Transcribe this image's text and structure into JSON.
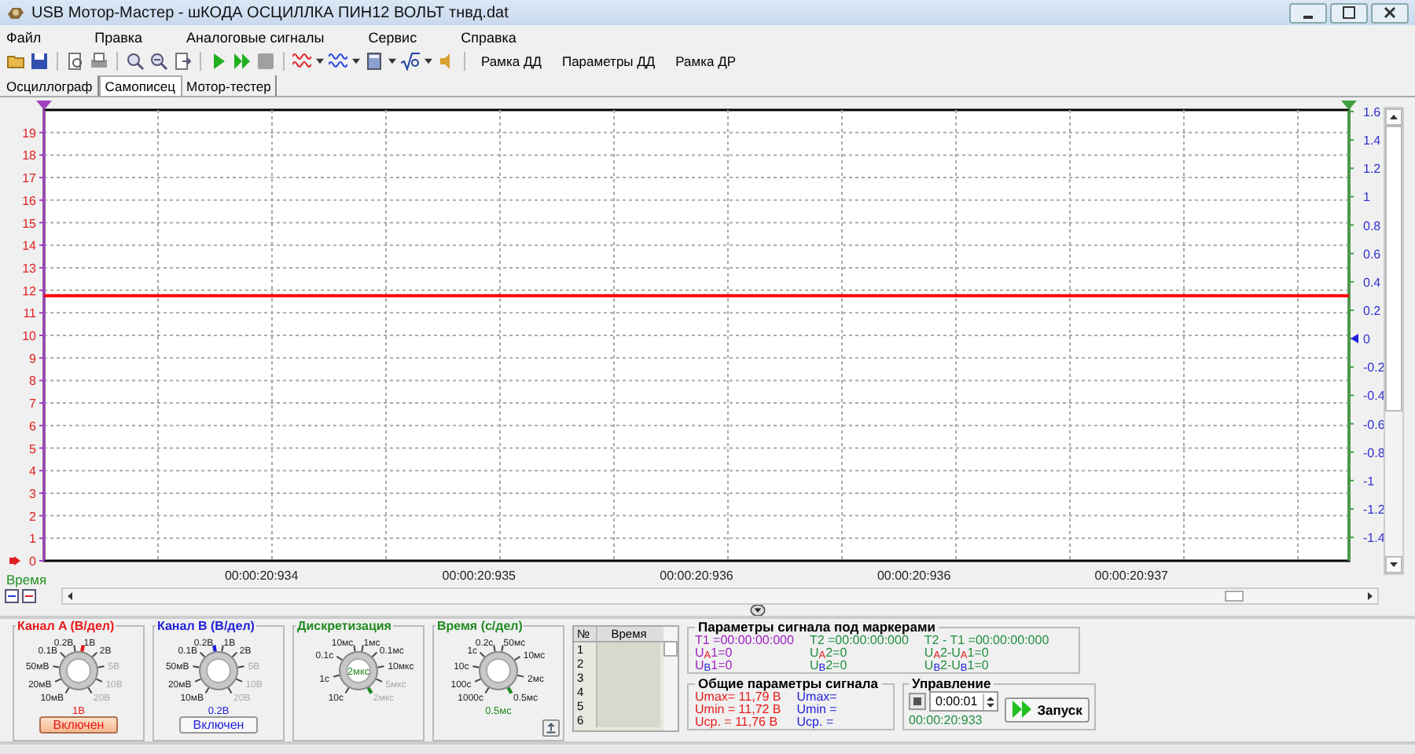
{
  "window": {
    "title": "USB Мотор-Мастер - шКОДА ОСЦИЛЛКА ПИН12 ВОЛЬТ тнвд.dat"
  },
  "menu": [
    "Файл",
    "Правка",
    "Аналоговые сигналы",
    "Сервис",
    "Справка"
  ],
  "toolbar": {
    "stop": {
      "disabled": true
    },
    "text_buttons": [
      "Рамка ДД",
      "Параметры ДД",
      "Рамка ДР"
    ]
  },
  "tabs": [
    {
      "label": "Осциллограф",
      "selected": false
    },
    {
      "label": "Самописец",
      "selected": true
    },
    {
      "label": "Мотор-тестер",
      "selected": false
    }
  ],
  "chart": {
    "chart_data": {
      "type": "line",
      "xlabel": "Время",
      "ylim": [
        0,
        20
      ],
      "grid": true,
      "categories": [
        null,
        "00:00:20:934",
        "00:00:20:935",
        "00:00:20:936",
        "00:00:20:936",
        "00:00:20:937",
        null
      ],
      "yticks": [
        0,
        1,
        2,
        3,
        4,
        5,
        6,
        7,
        8,
        9,
        10,
        11,
        12,
        13,
        14,
        15,
        16,
        17,
        18,
        19
      ],
      "series": [
        {
          "color": "#ff0000",
          "values": [
            11.76,
            11.76,
            11.76,
            11.76,
            11.76,
            11.76,
            11.76
          ]
        }
      ]
    },
    "right_axis": {
      "ticks": [
        "1.6",
        "1.4",
        "1.2",
        "1",
        "0.8",
        "0.6",
        "0.4",
        "0.2",
        "0",
        "-0.2",
        "-0.4",
        "-0.6",
        "-0.8",
        "-1",
        "-1.2",
        "-1.4"
      ]
    }
  },
  "dials": [
    {
      "title": "Канал A (В/дел)",
      "color": "#e81818",
      "kind": "value-below",
      "value": "1В",
      "left_labels": [
        {
          "text": "0.2В",
          "dimmed": false,
          "selected": false
        },
        {
          "text": "0.1В",
          "dimmed": false,
          "selected": false
        },
        {
          "text": "50мВ",
          "dimmed": false,
          "selected": false
        },
        {
          "text": "20мВ",
          "dimmed": false,
          "selected": false
        },
        {
          "text": "10мВ",
          "dimmed": false,
          "selected": false
        }
      ],
      "right_labels": [
        {
          "text": "1В",
          "dimmed": false,
          "selected": true
        },
        {
          "text": "2В",
          "dimmed": false,
          "selected": false
        },
        {
          "text": "5В",
          "dimmed": true,
          "selected": false
        },
        {
          "text": "10В",
          "dimmed": true,
          "selected": false
        },
        {
          "text": "20В",
          "dimmed": true,
          "selected": false
        }
      ],
      "button": {
        "label": "Включен",
        "pressed": true
      }
    },
    {
      "title": "Канал B (В/дел)",
      "color": "#2020d8",
      "kind": "value-below",
      "value": "0.2В",
      "left_labels": [
        {
          "text": "0.2В",
          "dimmed": false,
          "selected": true
        },
        {
          "text": "0.1В",
          "dimmed": false,
          "selected": false
        },
        {
          "text": "50мВ",
          "dimmed": false,
          "selected": false
        },
        {
          "text": "20мВ",
          "dimmed": false,
          "selected": false
        },
        {
          "text": "10мВ",
          "dimmed": false,
          "selected": false
        }
      ],
      "right_labels": [
        {
          "text": "1В",
          "dimmed": false,
          "selected": false
        },
        {
          "text": "2В",
          "dimmed": false,
          "selected": false
        },
        {
          "text": "5В",
          "dimmed": true,
          "selected": false
        },
        {
          "text": "10В",
          "dimmed": true,
          "selected": false
        },
        {
          "text": "20В",
          "dimmed": true,
          "selected": false
        }
      ],
      "button": {
        "label": "Включен",
        "pressed": false
      }
    },
    {
      "title": "Дискретизация",
      "color": "#208a20",
      "kind": "value-inside",
      "value": "2мкс",
      "left_labels": [
        {
          "text": "10мс",
          "dimmed": false,
          "selected": false
        },
        {
          "text": "0.1с",
          "dimmed": false,
          "selected": false
        },
        {
          "text": "1с",
          "dimmed": false,
          "selected": false
        },
        {
          "text": "10с",
          "dimmed": false,
          "selected": false
        }
      ],
      "right_labels": [
        {
          "text": "1мс",
          "dimmed": false,
          "selected": false
        },
        {
          "text": "0.1мс",
          "dimmed": false,
          "selected": false
        },
        {
          "text": "10мкс",
          "dimmed": false,
          "selected": false
        },
        {
          "text": "5мкс",
          "dimmed": true,
          "selected": false
        },
        {
          "text": "2мкс",
          "dimmed": true,
          "selected": true
        }
      ]
    },
    {
      "title": "Время (с/дел)",
      "color": "#208a20",
      "kind": "value-below",
      "value": "0.5мс",
      "icon_button": true,
      "left_labels": [
        {
          "text": "0.2с",
          "dimmed": false,
          "selected": false
        },
        {
          "text": "1с",
          "dimmed": false,
          "selected": false
        },
        {
          "text": "10с",
          "dimmed": false,
          "selected": false
        },
        {
          "text": "100с",
          "dimmed": false,
          "selected": false
        },
        {
          "text": "1000с",
          "dimmed": false,
          "selected": false
        }
      ],
      "right_labels": [
        {
          "text": "50мс",
          "dimmed": false,
          "selected": false
        },
        {
          "text": "10мс",
          "dimmed": false,
          "selected": false
        },
        {
          "text": "2мс",
          "dimmed": false,
          "selected": false
        },
        {
          "text": "0.5мс",
          "dimmed": false,
          "selected": true
        }
      ]
    }
  ],
  "table": {
    "columns": [
      "№",
      "Время"
    ],
    "rows": [
      "1",
      "2",
      "3",
      "4",
      "5",
      "6"
    ]
  },
  "markers": {
    "title": "Параметры сигнала под маркерами",
    "columns": [
      {
        "color": "#a020c0",
        "items": [
          "T1 =00:00:00:000",
          "U$_{A}$1=0",
          "U$_{B}$1=0"
        ]
      },
      {
        "color": "#209040",
        "items": [
          "T2 =00:00:00:000",
          "U$_{A}$2=0",
          "U$_{B}$2=0"
        ]
      },
      {
        "color": "#209040",
        "items": [
          "T2 - T1 =00:00:00:000",
          "U$_{A}$2-U$_{A}$1=0",
          "U$_{B}$2-U$_{B}$1=0"
        ]
      }
    ]
  },
  "general": {
    "title": "Общие параметры сигнала",
    "columns": [
      {
        "color": "#e81818",
        "items": [
          "Umax= 11,79 В",
          "Umin = 11,72 В",
          "Uср. = 11,76 В"
        ]
      },
      {
        "color": "#2020d8",
        "items": [
          "Umax=",
          "Umin =",
          "Uср. ="
        ]
      }
    ]
  },
  "control": {
    "title": "Управление",
    "interval": "0:00:01",
    "time": "00:00:20:933",
    "start_button": "Запуск"
  }
}
